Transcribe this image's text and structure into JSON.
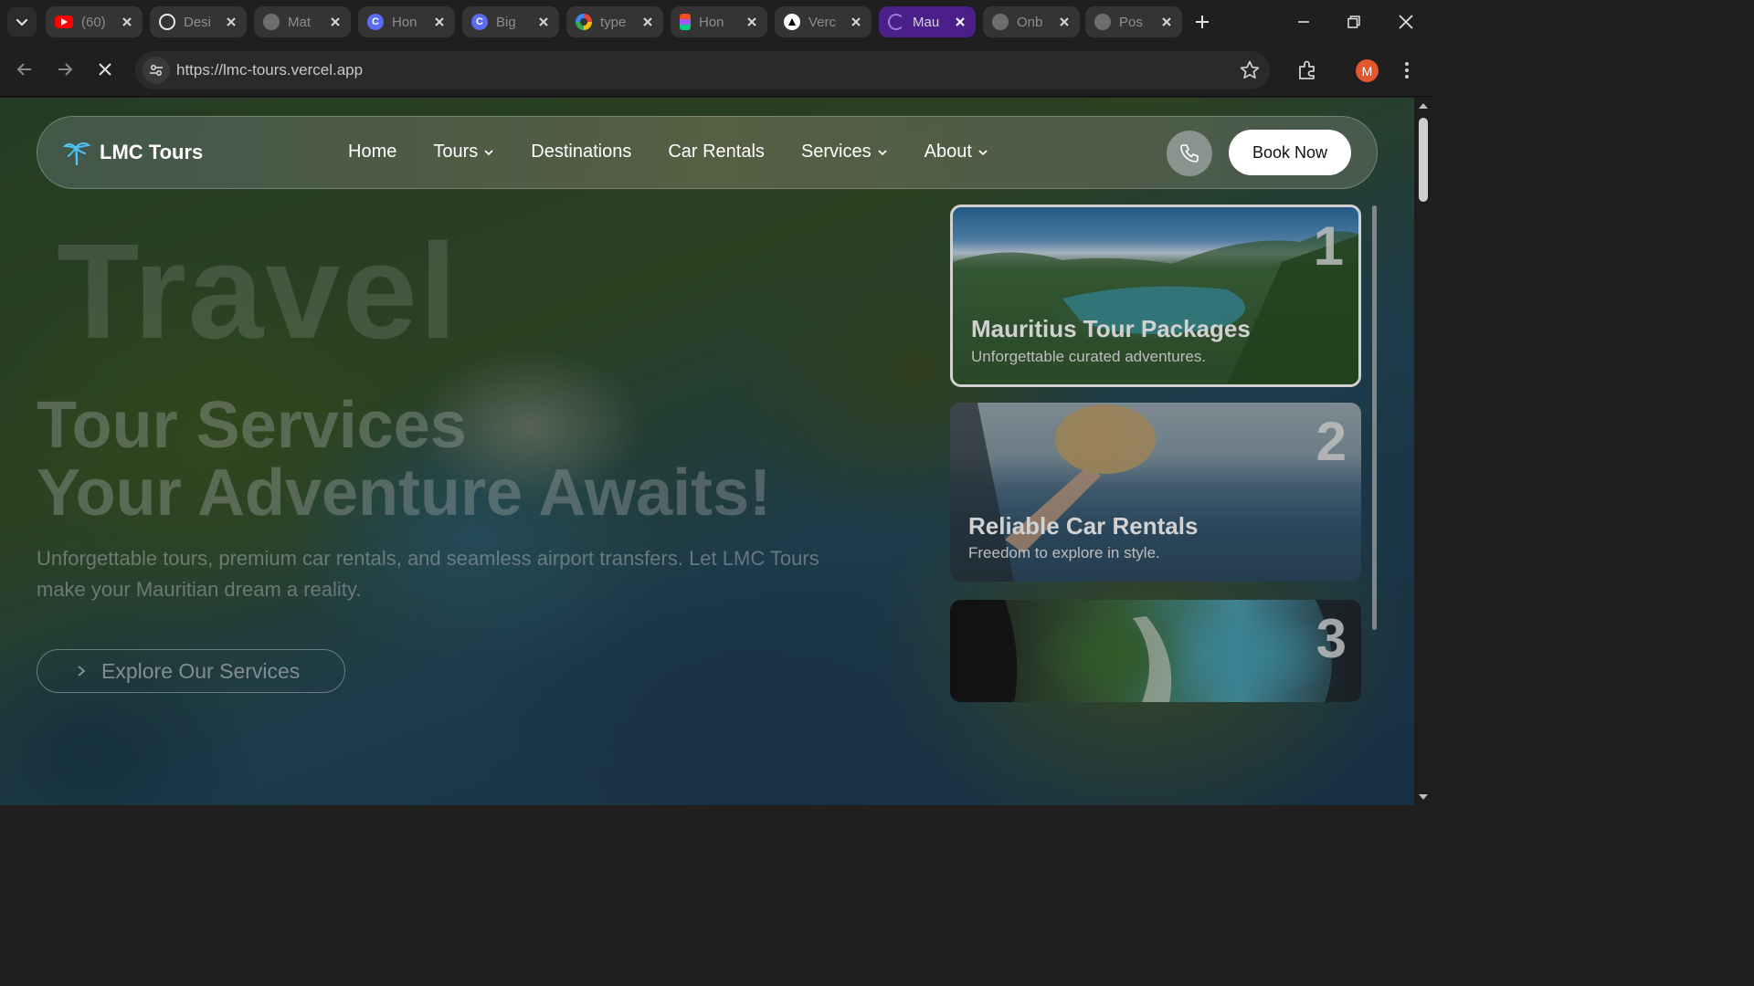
{
  "browser": {
    "tabs": [
      {
        "title": "(60)",
        "favicon": "youtube-icon",
        "color": "#ff0000"
      },
      {
        "title": "Desi",
        "favicon": "openai-icon",
        "color": "#ffffff"
      },
      {
        "title": "Mat",
        "favicon": "globe-icon",
        "color": "#7a7a7a"
      },
      {
        "title": "Hon",
        "favicon": "c-logo-icon",
        "color": "#5b6cf6"
      },
      {
        "title": "Big",
        "favicon": "c-logo-icon",
        "color": "#5b6cf6"
      },
      {
        "title": "type",
        "favicon": "google-icon",
        "color": "#ffffff"
      },
      {
        "title": "Hon",
        "favicon": "figma-icon",
        "color": "#f24e1e"
      },
      {
        "title": "Verc",
        "favicon": "vercel-icon",
        "color": "#ffffff"
      },
      {
        "title": "Mau",
        "favicon": "loading-spinner-icon",
        "color": "#9b7bd8",
        "active": true
      },
      {
        "title": "Onb",
        "favicon": "globe-icon",
        "color": "#7a7a7a"
      },
      {
        "title": "Pos",
        "favicon": "globe-icon",
        "color": "#7a7a7a"
      }
    ],
    "url": "https://lmc-tours.vercel.app",
    "profile_initial": "M",
    "profile_color": "#e4572e",
    "active_tab_color": "#4b1f8a"
  },
  "site": {
    "brand": "LMC Tours",
    "nav": [
      {
        "label": "Home",
        "dropdown": false
      },
      {
        "label": "Tours",
        "dropdown": true
      },
      {
        "label": "Destinations",
        "dropdown": false
      },
      {
        "label": "Car Rentals",
        "dropdown": false
      },
      {
        "label": "Services",
        "dropdown": true
      },
      {
        "label": "About",
        "dropdown": true
      }
    ],
    "book_label": "Book Now",
    "accent_color": "#4fc3f7"
  },
  "hero": {
    "bg_word": "Travel",
    "title_line1": "Tour Services",
    "title_line2": "Your Adventure Awaits!",
    "subtitle": "Unforgettable tours, premium car rentals, and seamless airport transfers. Let LMC Tours make your Mauritian dream a reality.",
    "cta": "Explore Our Services"
  },
  "cards": [
    {
      "num": "1",
      "title": "Mauritius Tour Packages",
      "desc": "Unforgettable curated adventures."
    },
    {
      "num": "2",
      "title": "Reliable Car Rentals",
      "desc": "Freedom to explore in style."
    },
    {
      "num": "3",
      "title": "",
      "desc": ""
    }
  ]
}
